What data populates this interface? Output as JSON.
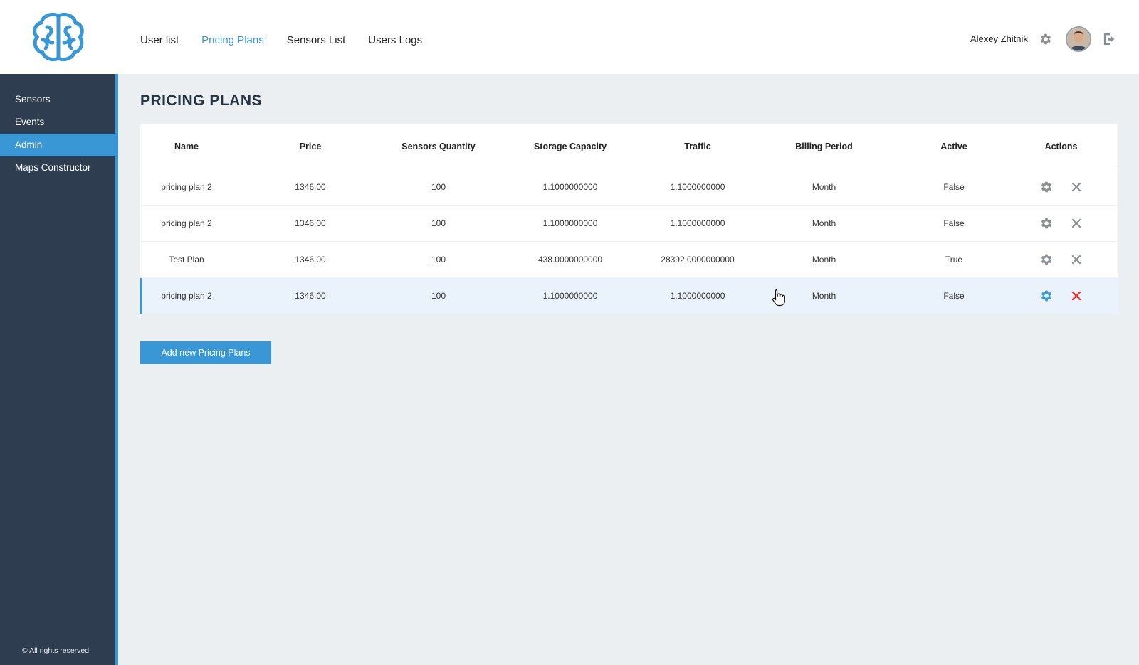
{
  "header": {
    "nav": [
      {
        "label": "User list",
        "active": false
      },
      {
        "label": "Pricing Plans",
        "active": true
      },
      {
        "label": "Sensors List",
        "active": false
      },
      {
        "label": "Users Logs",
        "active": false
      }
    ],
    "user_name": "Alexey Zhitnik",
    "icons": {
      "logo": "brain-logo-icon",
      "settings": "gear-icon",
      "logout": "logout-icon"
    }
  },
  "sidebar": {
    "items": [
      {
        "label": "Sensors",
        "active": false
      },
      {
        "label": "Events",
        "active": false
      },
      {
        "label": "Admin",
        "active": true
      },
      {
        "label": "Maps Constructor",
        "active": false
      }
    ],
    "copyright": "© All rights reserved"
  },
  "main": {
    "title": "PRICING PLANS",
    "columns": [
      "Name",
      "Price",
      "Sensors Quantity",
      "Storage Capacity",
      "Traffic",
      "Billing Period",
      "Active",
      "Actions"
    ],
    "rows": [
      {
        "name": "pricing plan 2",
        "price": "1346.00",
        "sensors": "100",
        "storage": "1.1000000000",
        "traffic": "1.1000000000",
        "billing": "Month",
        "active": "False"
      },
      {
        "name": "pricing plan 2",
        "price": "1346.00",
        "sensors": "100",
        "storage": "1.1000000000",
        "traffic": "1.1000000000",
        "billing": "Month",
        "active": "False"
      },
      {
        "name": "Test Plan",
        "price": "1346.00",
        "sensors": "100",
        "storage": "438.0000000000",
        "traffic": "28392.0000000000",
        "billing": "Month",
        "active": "True"
      },
      {
        "name": "pricing plan 2",
        "price": "1346.00",
        "sensors": "100",
        "storage": "1.1000000000",
        "traffic": "1.1000000000",
        "billing": "Month",
        "active": "False"
      }
    ],
    "highlighted_row": 3,
    "add_button": "Add new Pricing Plans"
  },
  "colors": {
    "accent": "#3a97d6",
    "sidebar_bg": "#2e3d4f",
    "delete_active": "#e53935",
    "icon_gray": "#8a8f93"
  }
}
